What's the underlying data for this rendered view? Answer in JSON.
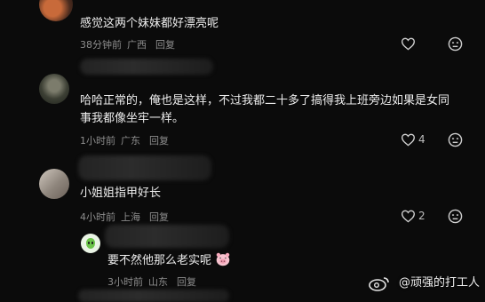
{
  "comments": [
    {
      "text": "感觉这两个妹妹都好漂亮呢",
      "time": "38分钟前",
      "location": "广西",
      "reply": "回复",
      "likes": ""
    },
    {
      "text_line1": "哈哈正常的，俺也是这样，不过我都二十多了搞得我上班旁边如果是女同",
      "text_line2": "事我都像坐牢一样。",
      "time": "1小时前",
      "location": "广东",
      "reply": "回复",
      "likes": "4"
    },
    {
      "text": "小姐姐指甲好长",
      "time": "4小时前",
      "location": "上海",
      "reply": "回复",
      "likes": "2"
    },
    {
      "text": "要不然他那么老实呢",
      "time": "3小时前",
      "location": "山东",
      "reply": "回复",
      "likes": ""
    }
  ],
  "watermark": "@顽强的打工人",
  "icons": {
    "like": "heart-icon",
    "dislike": "dislike-face-icon",
    "avatar_emoji": "pig-face-emoji"
  }
}
